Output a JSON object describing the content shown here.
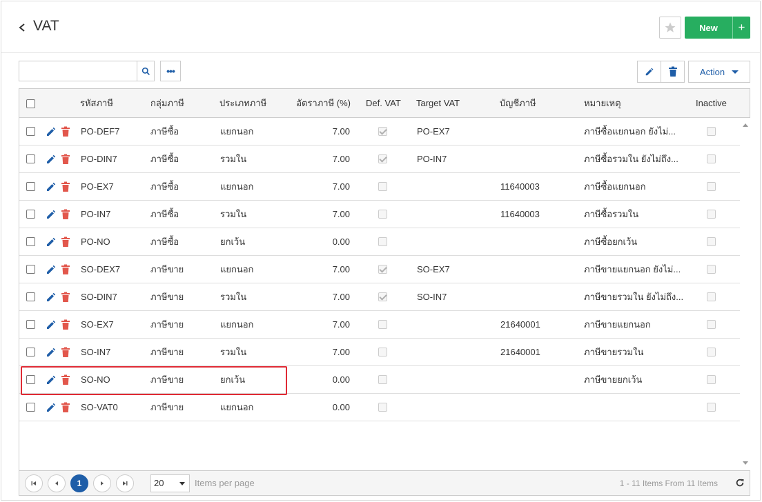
{
  "header": {
    "title": "VAT",
    "new_label": "New",
    "plus_label": "+"
  },
  "toolbar": {
    "search_value": "",
    "more_label": "•••",
    "action_label": "Action"
  },
  "columns": [
    "รหัสภาษี",
    "กลุ่มภาษี",
    "ประเภทภาษี",
    "อัตราภาษี (%)",
    "Def. VAT",
    "Target VAT",
    "บัญชีภาษี",
    "หมายเหตุ",
    "Inactive"
  ],
  "rows": [
    {
      "code": "PO-DEF7",
      "group": "ภาษีซื้อ",
      "type": "แยกนอก",
      "rate": "7.00",
      "def_vat": true,
      "target": "PO-EX7",
      "account": "",
      "note": "ภาษีซื้อแยกนอก ยังไม่...",
      "inactive": false
    },
    {
      "code": "PO-DIN7",
      "group": "ภาษีซื้อ",
      "type": "รวมใน",
      "rate": "7.00",
      "def_vat": true,
      "target": "PO-IN7",
      "account": "",
      "note": "ภาษีซื้อรวมใน ยังไม่ถึง...",
      "inactive": false
    },
    {
      "code": "PO-EX7",
      "group": "ภาษีซื้อ",
      "type": "แยกนอก",
      "rate": "7.00",
      "def_vat": false,
      "target": "",
      "account": "11640003",
      "note": "ภาษีซื้อแยกนอก",
      "inactive": false
    },
    {
      "code": "PO-IN7",
      "group": "ภาษีซื้อ",
      "type": "รวมใน",
      "rate": "7.00",
      "def_vat": false,
      "target": "",
      "account": "11640003",
      "note": "ภาษีซื้อรวมใน",
      "inactive": false
    },
    {
      "code": "PO-NO",
      "group": "ภาษีซื้อ",
      "type": "ยกเว้น",
      "rate": "0.00",
      "def_vat": false,
      "target": "",
      "account": "",
      "note": "ภาษีซื้อยกเว้น",
      "inactive": false
    },
    {
      "code": "SO-DEX7",
      "group": "ภาษีขาย",
      "type": "แยกนอก",
      "rate": "7.00",
      "def_vat": true,
      "target": "SO-EX7",
      "account": "",
      "note": "ภาษีขายแยกนอก ยังไม่...",
      "inactive": false
    },
    {
      "code": "SO-DIN7",
      "group": "ภาษีขาย",
      "type": "รวมใน",
      "rate": "7.00",
      "def_vat": true,
      "target": "SO-IN7",
      "account": "",
      "note": "ภาษีขายรวมใน ยังไม่ถึง...",
      "inactive": false
    },
    {
      "code": "SO-EX7",
      "group": "ภาษีขาย",
      "type": "แยกนอก",
      "rate": "7.00",
      "def_vat": false,
      "target": "",
      "account": "21640001",
      "note": "ภาษีขายแยกนอก",
      "inactive": false
    },
    {
      "code": "SO-IN7",
      "group": "ภาษีขาย",
      "type": "รวมใน",
      "rate": "7.00",
      "def_vat": false,
      "target": "",
      "account": "21640001",
      "note": "ภาษีขายรวมใน",
      "inactive": false
    },
    {
      "code": "SO-NO",
      "group": "ภาษีขาย",
      "type": "ยกเว้น",
      "rate": "0.00",
      "def_vat": false,
      "target": "",
      "account": "",
      "note": "ภาษีขายยกเว้น",
      "inactive": false
    },
    {
      "code": "SO-VAT0",
      "group": "ภาษีขาย",
      "type": "แยกนอก",
      "rate": "0.00",
      "def_vat": false,
      "target": "",
      "account": "",
      "note": "",
      "inactive": false
    }
  ],
  "pager": {
    "current_page": "1",
    "page_size": "20",
    "items_per_page_label": "Items per page",
    "info": "1 - 11 Items From 11 Items"
  },
  "icons": {
    "back": "chevron-left-icon",
    "favorite": "star-icon",
    "search": "search-icon",
    "edit": "pencil-icon",
    "delete": "trash-icon",
    "refresh": "refresh-icon"
  },
  "colors": {
    "primary": "#1f5ea8",
    "success": "#27ae60",
    "danger": "#e2574c",
    "highlight": "#e02b35"
  }
}
